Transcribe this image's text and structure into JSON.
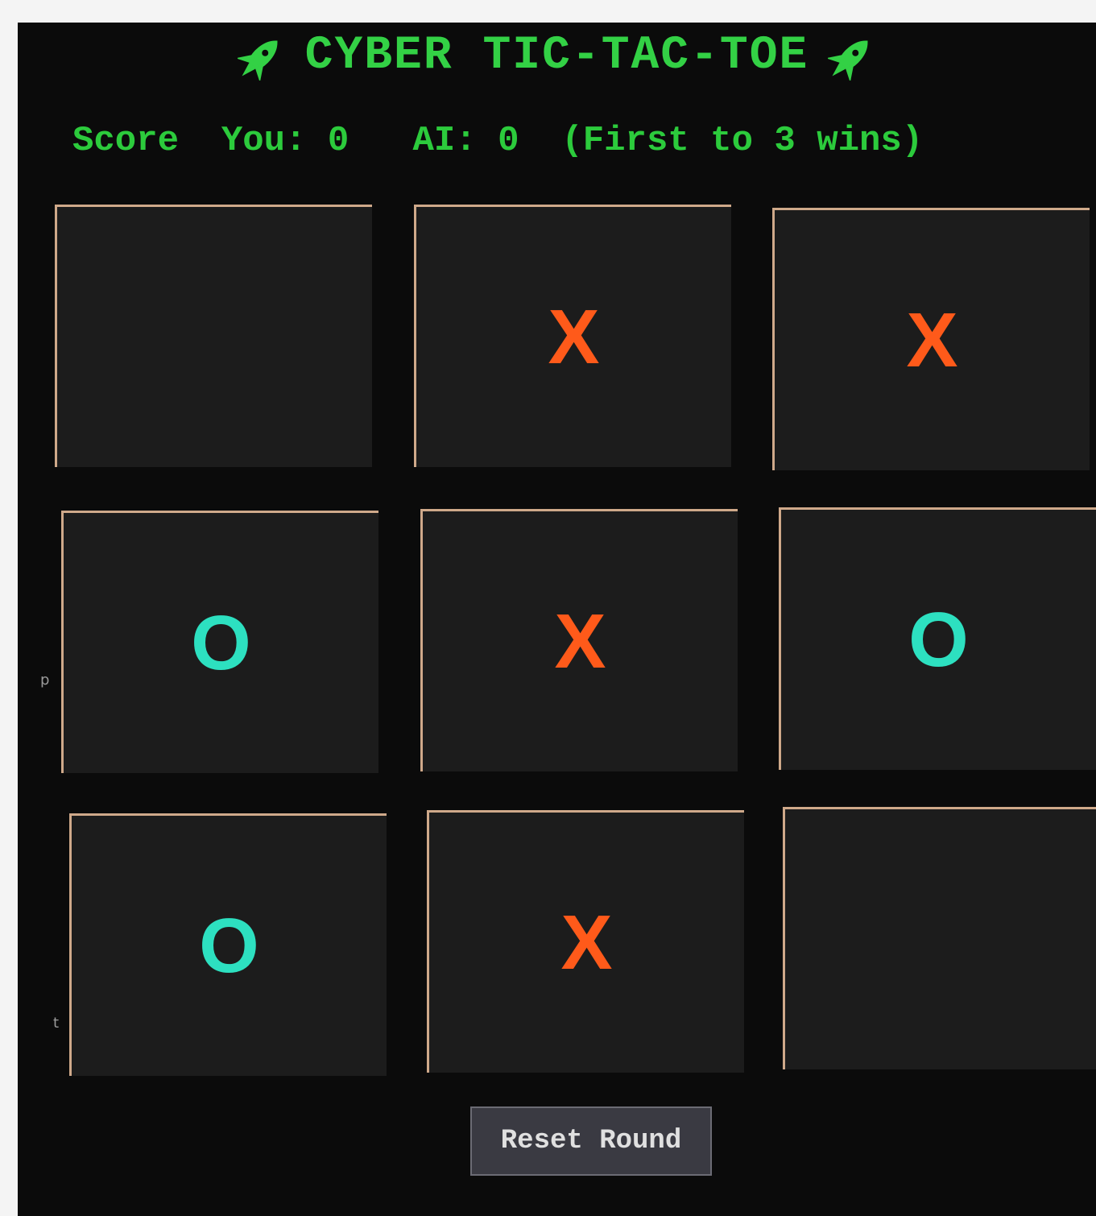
{
  "header": {
    "title": "CYBER TIC-TAC-TOE",
    "title_icon": "rocket-icon",
    "title_color": "#33d145"
  },
  "score": {
    "label": "Score",
    "you_label": "You:",
    "you_value": "0",
    "ai_label": "AI:",
    "ai_value": "0",
    "rule": "(First to 3 wins)"
  },
  "board": {
    "cells": [
      "",
      "X",
      "X",
      "O",
      "X",
      "O",
      "O",
      "X",
      ""
    ],
    "x_color": "#ff5a1a",
    "o_color": "#2de0c0",
    "cell_bg": "#1c1c1c",
    "border_color": "#cfa98a"
  },
  "controls": {
    "reset_label": "Reset Round"
  },
  "edge_glyphs": [
    "p",
    "t"
  ]
}
